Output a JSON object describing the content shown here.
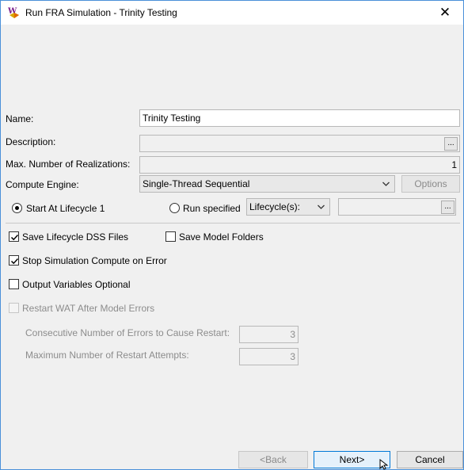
{
  "window": {
    "title": "Run FRA Simulation - Trinity Testing",
    "close_glyph": "✕"
  },
  "form": {
    "name_label": "Name:",
    "name_value": "Trinity Testing",
    "description_label": "Description:",
    "description_value": "",
    "description_browse": "...",
    "max_realizations_label": "Max. Number of Realizations:",
    "max_realizations_value": "1",
    "compute_engine_label": "Compute Engine:",
    "compute_engine_value": "Single-Thread Sequential",
    "options_button": "Options",
    "start_at_lifecycle_label": "Start At Lifecycle 1",
    "start_at_lifecycle_selected": true,
    "run_specified_label": "Run specified",
    "run_specified_selected": false,
    "lifecycle_combo_value": "Lifecycle(s):",
    "lifecycle_field_value": "",
    "lifecycle_browse": "..."
  },
  "options": {
    "save_lifecycle_dss": {
      "label": "Save Lifecycle DSS Files",
      "checked": true
    },
    "save_model_folders": {
      "label": "Save Model Folders",
      "checked": false
    },
    "stop_on_error": {
      "label": "Stop Simulation Compute on Error",
      "checked": true
    },
    "output_variables_optional": {
      "label": "Output Variables Optional",
      "checked": false
    },
    "restart_wat": {
      "label": "Restart WAT After Model Errors",
      "checked": false,
      "disabled": true
    },
    "consecutive_errors_label": "Consecutive Number of Errors to Cause Restart:",
    "consecutive_errors_value": "3",
    "max_restart_label": "Maximum Number of Restart Attempts:",
    "max_restart_value": "3"
  },
  "footer": {
    "back_button": "<Back",
    "next_button": "Next>",
    "cancel_button": "Cancel"
  },
  "colors": {
    "window_border": "#4a90d9",
    "primary_button_border": "#0078d7",
    "disabled_text": "#8c8c8c"
  }
}
